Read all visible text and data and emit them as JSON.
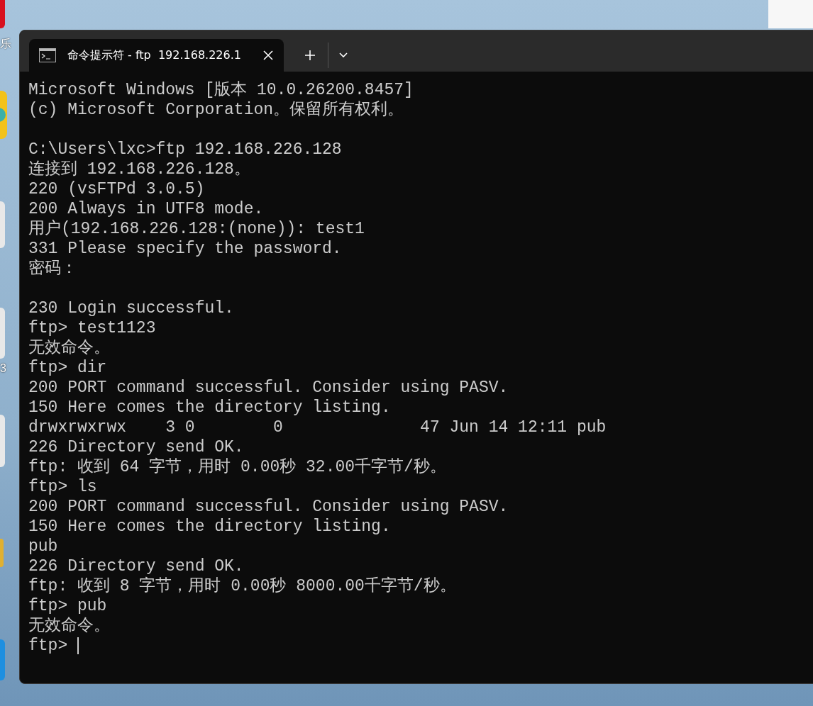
{
  "desktop": {
    "icon_labels": [
      "乐",
      "3"
    ]
  },
  "window": {
    "tabs": [
      {
        "title": "命令提示符 - ftp  192.168.226.1",
        "selected": true
      }
    ]
  },
  "terminal": {
    "blocks": [
      [
        "Microsoft Windows [版本 10.0.26200.8457]",
        "(c) Microsoft Corporation。保留所有权利。"
      ],
      [
        "C:\\Users\\lxc>ftp 192.168.226.128",
        "连接到 192.168.226.128。",
        "220 (vsFTPd 3.0.5)",
        "200 Always in UTF8 mode.",
        "用户(192.168.226.128:(none)): test1",
        "331 Please specify the password.",
        "密码："
      ],
      [
        "230 Login successful.",
        "ftp> test1123",
        "无效命令。",
        "ftp> dir",
        "200 PORT command successful. Consider using PASV.",
        "150 Here comes the directory listing.",
        "drwxrwxrwx    3 0        0              47 Jun 14 12:11 pub",
        "226 Directory send OK.",
        "ftp: 收到 64 字节，用时 0.00秒 32.00千字节/秒。",
        "ftp> ls",
        "200 PORT command successful. Consider using PASV.",
        "150 Here comes the directory listing.",
        "pub",
        "226 Directory send OK.",
        "ftp: 收到 8 字节，用时 0.00秒 8000.00千字节/秒。",
        "ftp> pub",
        "无效命令。"
      ]
    ],
    "prompt": "ftp> "
  }
}
